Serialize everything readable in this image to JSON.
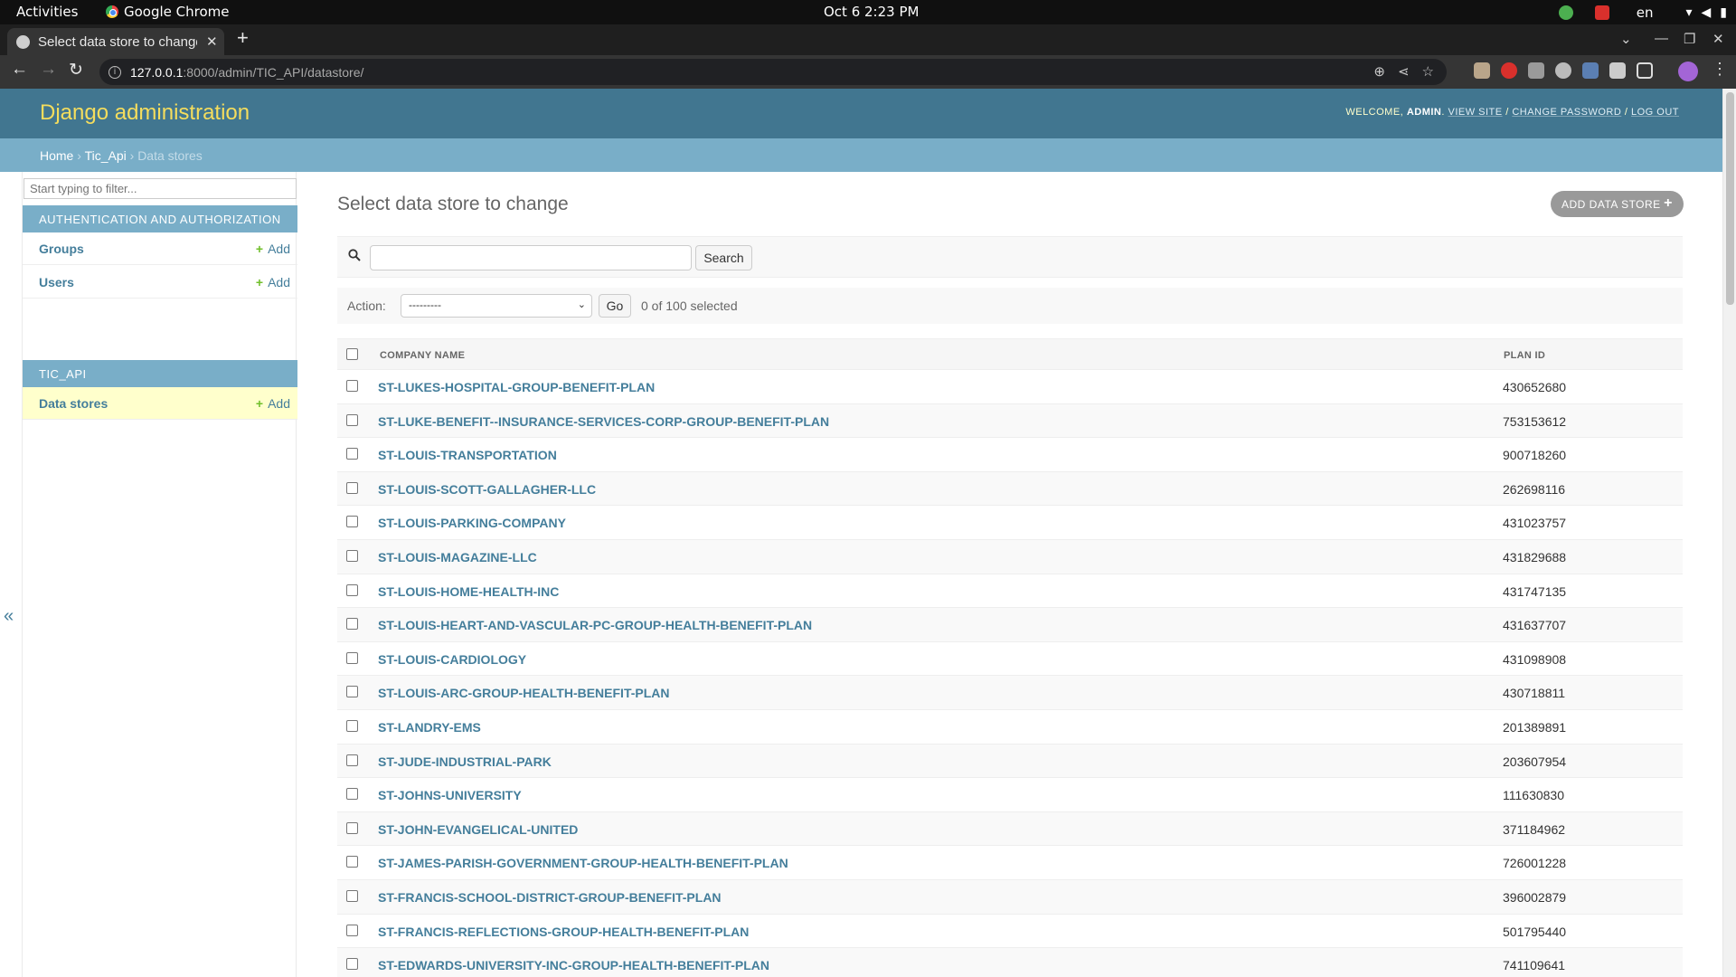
{
  "os": {
    "activities": "Activities",
    "app": "Google Chrome",
    "clock": "Oct 6  2:23 PM",
    "lang": "en"
  },
  "browser": {
    "tab_title": "Select data store to change",
    "url_host": "127.0.0.1",
    "url_path": ":8000/admin/TIC_API/datastore/"
  },
  "header": {
    "branding": "Django administration",
    "welcome": "WELCOME,",
    "user": "ADMIN",
    "view_site": "VIEW SITE",
    "change_password": "CHANGE PASSWORD",
    "log_out": "LOG OUT",
    "sep": "/"
  },
  "breadcrumbs": {
    "home": "Home",
    "app": "Tic_Api",
    "current": "Data stores",
    "sep": "›"
  },
  "sidebar": {
    "filter_placeholder": "Start typing to filter...",
    "modules": [
      {
        "caption": "AUTHENTICATION AND AUTHORIZATION",
        "models": [
          {
            "name": "Groups",
            "add": "Add"
          },
          {
            "name": "Users",
            "add": "Add"
          }
        ]
      },
      {
        "caption": "TIC_API",
        "models": [
          {
            "name": "Data stores",
            "add": "Add"
          }
        ]
      }
    ],
    "toggle": "«"
  },
  "content": {
    "title": "Select data store to change",
    "add_button": "ADD DATA STORE",
    "search_button": "Search",
    "action_label": "Action:",
    "action_selected": "---------",
    "go_button": "Go",
    "selected_count": "0 of 100 selected",
    "columns": [
      "COMPANY NAME",
      "PLAN ID"
    ],
    "rows": [
      {
        "company": "ST-LUKES-HOSPITAL-GROUP-BENEFIT-PLAN",
        "plan": "430652680"
      },
      {
        "company": "ST-LUKE-BENEFIT--INSURANCE-SERVICES-CORP-GROUP-BENEFIT-PLAN",
        "plan": "753153612"
      },
      {
        "company": "ST-LOUIS-TRANSPORTATION",
        "plan": "900718260"
      },
      {
        "company": "ST-LOUIS-SCOTT-GALLAGHER-LLC",
        "plan": "262698116"
      },
      {
        "company": "ST-LOUIS-PARKING-COMPANY",
        "plan": "431023757"
      },
      {
        "company": "ST-LOUIS-MAGAZINE-LLC",
        "plan": "431829688"
      },
      {
        "company": "ST-LOUIS-HOME-HEALTH-INC",
        "plan": "431747135"
      },
      {
        "company": "ST-LOUIS-HEART-AND-VASCULAR-PC-GROUP-HEALTH-BENEFIT-PLAN",
        "plan": "431637707"
      },
      {
        "company": "ST-LOUIS-CARDIOLOGY",
        "plan": "431098908"
      },
      {
        "company": "ST-LOUIS-ARC-GROUP-HEALTH-BENEFIT-PLAN",
        "plan": "430718811"
      },
      {
        "company": "ST-LANDRY-EMS",
        "plan": "201389891"
      },
      {
        "company": "ST-JUDE-INDUSTRIAL-PARK",
        "plan": "203607954"
      },
      {
        "company": "ST-JOHNS-UNIVERSITY",
        "plan": "111630830"
      },
      {
        "company": "ST-JOHN-EVANGELICAL-UNITED",
        "plan": "371184962"
      },
      {
        "company": "ST-JAMES-PARISH-GOVERNMENT-GROUP-HEALTH-BENEFIT-PLAN",
        "plan": "726001228"
      },
      {
        "company": "ST-FRANCIS-SCHOOL-DISTRICT-GROUP-BENEFIT-PLAN",
        "plan": "396002879"
      },
      {
        "company": "ST-FRANCIS-REFLECTIONS-GROUP-HEALTH-BENEFIT-PLAN",
        "plan": "501795440"
      },
      {
        "company": "ST-EDWARDS-UNIVERSITY-INC-GROUP-HEALTH-BENEFIT-PLAN",
        "plan": "741109641"
      }
    ]
  },
  "colors": {
    "header_bg": "#417690",
    "breadcrumb_bg": "#79aec8",
    "branding": "#f5dd5d",
    "link": "#447e9b",
    "add_plus": "#70bf2b",
    "current_model_bg": "#ffffcc"
  }
}
